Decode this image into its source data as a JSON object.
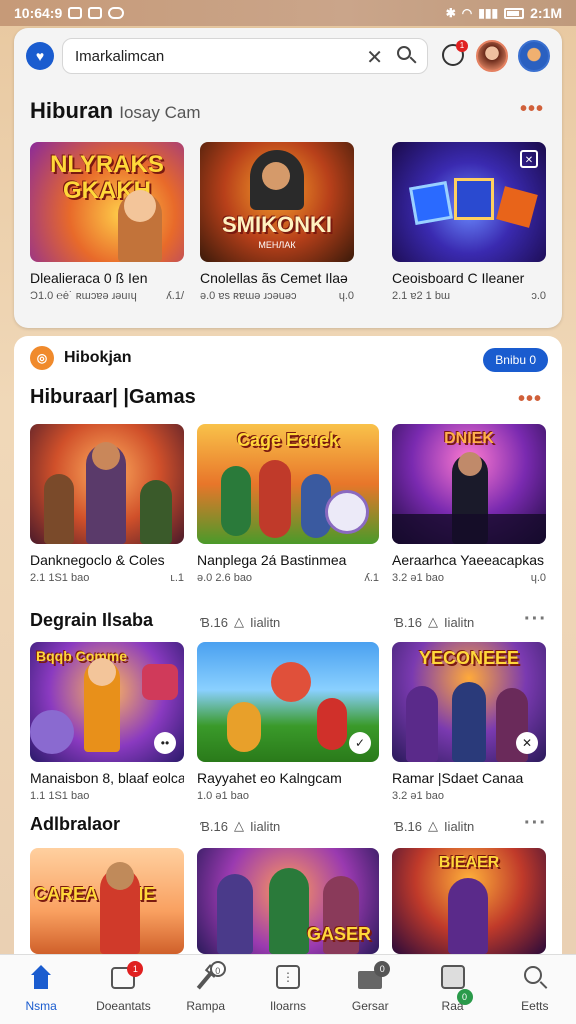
{
  "status": {
    "time": "10:64:9",
    "clock_right": "2:1M",
    "icons": [
      "message-icon",
      "facebook-icon",
      "video-icon"
    ],
    "right_icons": [
      "bluetooth-icon",
      "wifi-icon",
      "signal-icon",
      "battery-icon"
    ]
  },
  "search": {
    "value": "Imarkalimcan",
    "clear_glyph": "✕"
  },
  "header": {
    "notif_count": "1"
  },
  "section1": {
    "title": "Hiburan",
    "subtitle": "Iosay Cam",
    "more": "•••",
    "tiles": [
      {
        "thumb_text": "NLYRAKS GKAKH",
        "name": "Dlealieraca 0 ß Ien",
        "meta_left": "Ɔ1.0  ℮ė˙ ʀɯɔɐǝ ɹǝuıɥ",
        "meta_right": "ʎ.1/"
      },
      {
        "thumb_text": "SMIKONKI",
        "thumb_sub": "МЕНЛАК",
        "name": "Cnolellas ãs Cemet Ilaǝ",
        "meta_left": "ǝ.0 ɐs ʀɐɯǝ ɹɔǝuǝɔ",
        "meta_right": "ɥ.0"
      },
      {
        "thumb_text": "",
        "name": "Ceoisboard C Ileaner",
        "meta_left": "2.1  ɐ2 1 bɯ",
        "meta_right": "ɔ.0"
      }
    ]
  },
  "sheet": {
    "app_name": "Hibokjan",
    "app_icon_glyph": "◎",
    "pill_label": "Bnibu 0",
    "section2_title": "Hiburaar| |Gamas",
    "section2_more": "•••",
    "row2": [
      {
        "name": "Danknegoclo & Coles",
        "meta_left": "2.1 1S1 bao",
        "meta_right": "ʟ.1"
      },
      {
        "name": "Nanplega 2á Bastinmea",
        "thumb_text": "Cage Ecuek",
        "meta_left": "ǝ.0 2.6 bao",
        "meta_right": "ʎ.1"
      },
      {
        "name": "Aeraarhca Yaeeacapkas",
        "thumb_text": "DNIEK",
        "meta_left": "3.2 ǝ1 bao",
        "meta_right": "ɥ.0"
      }
    ],
    "section3_title": "Degrain Ilsaba",
    "section3_meta_a": "Ɓ.16",
    "section3_meta_b": "Iialitn",
    "row3": [
      {
        "name": "Manaisbon 8, blaaf eolcao",
        "thumb_text": "Bqqb Comme",
        "meta_left": "1.1 1S1 bao"
      },
      {
        "name": "Rayyahet eo Kalngcam",
        "meta_left": "1.0 ǝ1 bao"
      },
      {
        "name": "Ramar |Sdaet Canaa",
        "thumb_text": "YECONEEE",
        "meta_left": "3.2 ǝ1 bao"
      }
    ],
    "section4_title": "Adlbralaor",
    "section4_meta_a": "Ɓ.16",
    "section4_meta_b": "Iialitn",
    "row4": [
      {
        "thumb_text": "CAREA MANE"
      },
      {
        "thumb_text": "GASER"
      },
      {
        "thumb_text": "BIEAER"
      }
    ]
  },
  "nav": [
    {
      "label": "Nsma",
      "icon": "home-icon",
      "active": true
    },
    {
      "label": "Doeantats",
      "icon": "store-icon",
      "badge": "1"
    },
    {
      "label": "Rampa",
      "icon": "hammer-icon",
      "badge": "0"
    },
    {
      "label": "Iloarns",
      "icon": "grid-icon"
    },
    {
      "label": "Gersar",
      "icon": "folder-icon",
      "badge": "0"
    },
    {
      "label": "Raa",
      "icon": "inbox-icon",
      "badge": "0"
    },
    {
      "label": "Eetts",
      "icon": "search-icon"
    }
  ],
  "colors": {
    "accent": "#1a5ccf",
    "more_dots": "#d0603a",
    "badge_red": "#e02020",
    "badge_green": "#2a9a4a",
    "badge_dark": "#555555"
  }
}
